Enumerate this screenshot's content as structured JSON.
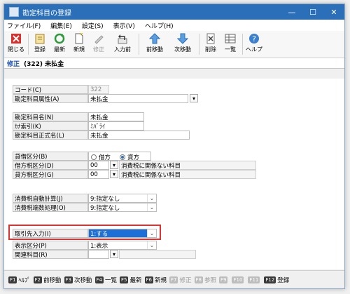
{
  "window": {
    "title": "勘定科目の登録",
    "min": "—",
    "max": "☐",
    "close": "✕"
  },
  "menu": [
    "ファイル(F)",
    "編集(E)",
    "設定(S)",
    "表示(V)",
    "ヘルプ(H)"
  ],
  "toolbar": {
    "close": "閉じる",
    "register": "登録",
    "refresh": "最新",
    "new": "新規",
    "edit": "修正",
    "prev_input": "入力前",
    "prev": "前移動",
    "next": "次移動",
    "delete": "削除",
    "list": "一覧",
    "help": "ヘルプ"
  },
  "mode": {
    "label": "修正",
    "record": "(322) 未払金"
  },
  "form": {
    "code": {
      "label": "コード(C)",
      "value": "322"
    },
    "attr": {
      "label": "勘定科目属性(A)",
      "value": "未払金",
      "btn": "▾"
    },
    "name": {
      "label": "勘定科目名(N)",
      "value": "未払金"
    },
    "kana": {
      "label": "ｶﾅ索引(K)",
      "value": "ﾐﾊﾞﾗｲ"
    },
    "formal": {
      "label": "勘定科目正式名(L)",
      "value": "未払金"
    },
    "dc": {
      "label": "貸借区分(B)",
      "debit": "借方",
      "credit": "貸方",
      "selected": "credit"
    },
    "debit_tax": {
      "label": "借方税区分(D)",
      "code": "00",
      "btn": "▾",
      "desc": "消費税に関係ない科目"
    },
    "credit_tax": {
      "label": "貸方税区分(G)",
      "code": "00",
      "btn": "▾",
      "desc": "消費税に関係ない科目"
    },
    "auto_calc": {
      "label": "消費税自動計算(J)",
      "value": "9:指定なし"
    },
    "rounding": {
      "label": "消費税端数処理(O)",
      "value": "9:指定なし"
    },
    "partner": {
      "label": "取引先入力(I)",
      "value": "1:する"
    },
    "display": {
      "label": "表示区分(P)",
      "value": "1:表示"
    },
    "related": {
      "label": "関連科目(R)",
      "btn": "▾"
    }
  },
  "fkeys": [
    {
      "key": "F1",
      "label": "ﾍﾙﾌﾟ",
      "enabled": true
    },
    {
      "key": "F2",
      "label": "前移動",
      "enabled": true
    },
    {
      "key": "F3",
      "label": "次移動",
      "enabled": true
    },
    {
      "key": "F4",
      "label": "一覧",
      "enabled": true
    },
    {
      "key": "F5",
      "label": "最新",
      "enabled": true
    },
    {
      "key": "F6",
      "label": "新規",
      "enabled": true
    },
    {
      "key": "F7",
      "label": "修正",
      "enabled": false
    },
    {
      "key": "F8",
      "label": "参照",
      "enabled": false
    },
    {
      "key": "F9",
      "label": "",
      "enabled": false
    },
    {
      "key": "F10",
      "label": "",
      "enabled": false
    },
    {
      "key": "F11",
      "label": "",
      "enabled": false
    },
    {
      "key": "F12",
      "label": "登録",
      "enabled": true
    }
  ],
  "colors": {
    "titlebar": "#2b6fb8",
    "highlight": "#e0332f",
    "mode_text": "#1a4fb0"
  }
}
